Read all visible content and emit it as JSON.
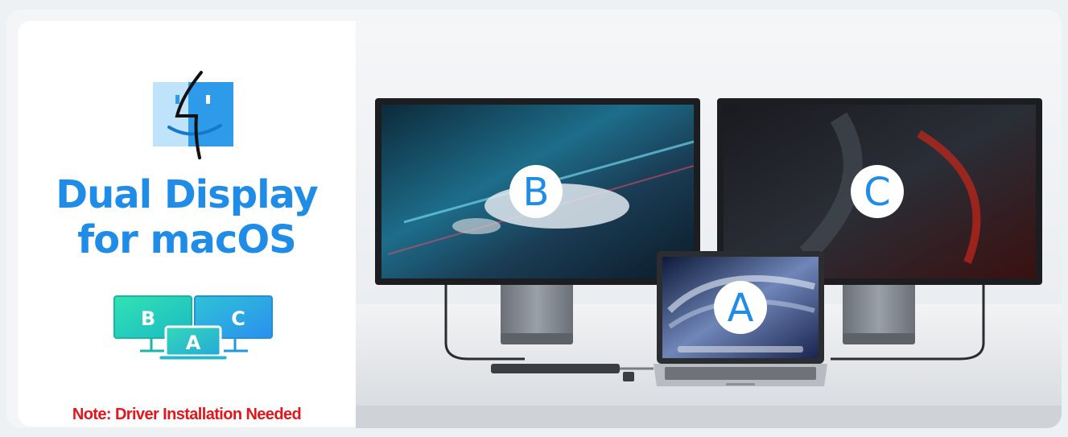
{
  "headline": {
    "line1": "Dual Display",
    "line2": "for macOS"
  },
  "layout_icon": {
    "left": "B",
    "right": "C",
    "center": "A"
  },
  "note": "Note: Driver Installation Needed",
  "displays": {
    "left_label": "B",
    "right_label": "C",
    "laptop_label": "A"
  },
  "colors": {
    "accent_blue": "#1f8de8",
    "note_red": "#e5161b",
    "icon_green": "#25d9b0",
    "icon_blue": "#2aa4f0"
  },
  "icons": [
    "finder-icon",
    "dual-display-layout-icon"
  ]
}
